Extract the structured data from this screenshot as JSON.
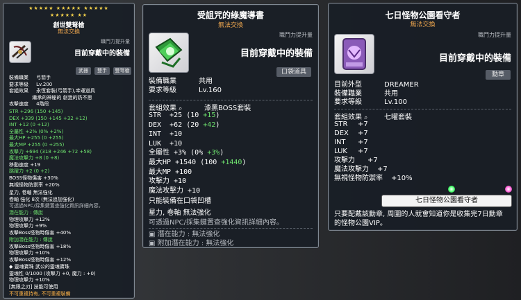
{
  "p1": {
    "stars": "★★★★★  ★★★★★  ★★★★★",
    "stars2": "★★★★★  ★★",
    "title": "創世雙弩槍",
    "no_trade": "無法交換",
    "job_power": "職鬥力提升量",
    "equipped": "目前穿戴中的裝備",
    "tags": [
      "武器",
      "雙手",
      "雙弩槍"
    ],
    "lines": [
      {
        "l": "裝備職業",
        "r": "弓箭手"
      },
      {
        "l": "要求等級",
        "r": "Lv.200"
      },
      {
        "l": "套組效果",
        "r": "永恆套裝(弓箭手),幸運道具"
      },
      {
        "l": "",
        "r": "繼承的神秘的 創造的奶不思"
      },
      {
        "l": "攻擊速度",
        "r": "4階段"
      }
    ],
    "stats": [
      "STR  +296 (150 +145)",
      "DEX  +339 (150 +145 +32 +12)",
      "INT  +12 (0 +12)",
      "全屬性  +2% (0% +2%)",
      "最大HP  +255 (0 +255)",
      "最大MP  +255 (0 +255)",
      "攻擊力  +694 (318 +246 +72 +58)",
      "魔法攻擊力  +8 (0 +8)",
      "移動速度  +19",
      "跳躍力  +2 (0 +2)",
      "BOSS怪物傷害  +30%",
      "無視怪物防禦率  +20%"
    ],
    "lower": [
      "星力, 卷軸 無法強化",
      "卷軸 強化 8次 (無法追加強化)",
      "可透過NPC/採集鍵置查強化資訊詳細內容。"
    ],
    "potential_title": "潛在能力 : 傳說",
    "potential": [
      "物理攻擊力 +12%",
      "物理攻擊力 +9%",
      "攻擊Boss怪物時傷害 +40%"
    ],
    "additional_title": "附加潛在能力 : 傳說",
    "additional": [
      "攻擊Boss怪物時傷害 +18%",
      "物理攻擊力 +10%",
      "攻擊Boss怪物時傷害 +12%"
    ],
    "soul_title": "◆ 靈魂寶珠    武公的靈魂寶珠",
    "soul": [
      "靈魂性  0/1000 (攻擊力 +0, 魔力 : +0)",
      "物理攻擊力 +10%",
      "[無限之刃] 技能可使用"
    ],
    "footer": "不可重複持有, 不可重複裝備"
  },
  "p2": {
    "title": "受詛咒的綠魔導書",
    "no_trade": "無法交換",
    "job_power": "職鬥力提升量",
    "equipped": "目前穿戴中的裝備",
    "tag": "口袋道具",
    "job_label": "裝備職業",
    "job_value": "共用",
    "level_label": "要求等級",
    "level_value": "Lv.160",
    "set_label": "套組效果",
    "set_value": "漆黑BOSS套裝",
    "stats": [
      {
        "l": "STR",
        "v": "+25 (10 ",
        "g": "+15",
        ")": ")"
      },
      {
        "l": "DEX",
        "v": "+62 (20 ",
        "g": "+42",
        ")": ")"
      },
      {
        "l": "INT",
        "v": "+10",
        "g": "",
        ")": ""
      },
      {
        "l": "LUK",
        "v": "+10",
        "g": "",
        ")": ""
      },
      {
        "l": "全屬性",
        "v": "+3% (0% ",
        "g": "+3%",
        ")": ")"
      },
      {
        "l": "最大HP",
        "v": "+1540 (100 ",
        "g": "+1440",
        ")": ")"
      },
      {
        "l": "最大MP",
        "v": "+100",
        "g": "",
        ")": ""
      },
      {
        "l": "攻擊力",
        "v": "+10",
        "g": "",
        ")": ""
      },
      {
        "l": "魔法攻擊力",
        "v": "+10",
        "g": "",
        ")": ""
      }
    ],
    "pocket_note": "只能裝備在口袋凹槽",
    "star_scroll": "星力, 卷軸  無法強化",
    "npc_note": "可透過NPC/採集鍵置查強化資訊詳細內容。",
    "potential": "潛在能力 : 無法強化",
    "additional": "附加潛在能力 : 無法強化"
  },
  "p3": {
    "title": "七日怪物公園看守者",
    "no_trade": "無法交換",
    "job_power": "職鬥力提升量",
    "equipped": "目前穿戴中的裝備",
    "tag": "勳章",
    "rows": [
      {
        "l": "目前外型",
        "r": "DREAMER"
      },
      {
        "l": "裝備職業",
        "r": "共用"
      },
      {
        "l": "要求等級",
        "r": "Lv.100"
      }
    ],
    "set_label": "套組效果",
    "set_value": "七曜套裝",
    "stats": [
      {
        "l": "STR",
        "v": "+7"
      },
      {
        "l": "DEX",
        "v": "+7"
      },
      {
        "l": "INT",
        "v": "+7"
      },
      {
        "l": "LUK",
        "v": "+7"
      },
      {
        "l": "攻擊力",
        "v": "+7"
      },
      {
        "l": "魔法攻擊力",
        "v": "+7"
      },
      {
        "l": "無視怪物防禦率",
        "v": "+10%"
      }
    ],
    "medal_label": "七日怪物公園看守者",
    "desc1": "只要配戴該勳章, 周圍的人就會知道你是收集完7日勳章",
    "desc2": "的怪物公園VIP。"
  },
  "colors": {
    "accent_green": "#6fe36f",
    "no_trade": "#f2a94f",
    "panel_bg": "#191e26"
  }
}
